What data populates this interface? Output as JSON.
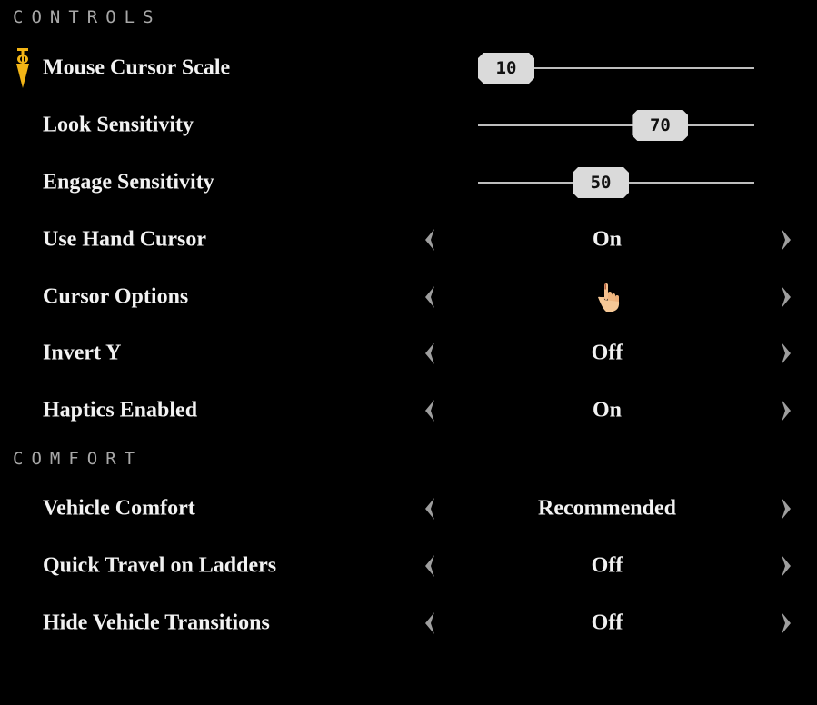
{
  "sections": {
    "controls": {
      "title": "CONTROLS",
      "sliders": [
        {
          "label": "Mouse Cursor Scale",
          "value": "10",
          "fraction": 0.0,
          "focused": true
        },
        {
          "label": "Look Sensitivity",
          "value": "70",
          "fraction": 0.7
        },
        {
          "label": "Engage Sensitivity",
          "value": "50",
          "fraction": 0.43
        }
      ],
      "selectors": [
        {
          "label": "Use Hand Cursor",
          "value": "On"
        },
        {
          "label": "Cursor Options",
          "value": "",
          "value_icon": "hand-pointer-cursor-icon"
        },
        {
          "label": "Invert Y",
          "value": "Off"
        },
        {
          "label": "Haptics Enabled",
          "value": "On"
        }
      ]
    },
    "comfort": {
      "title": "COMFORT",
      "selectors": [
        {
          "label": "Vehicle Comfort",
          "value": "Recommended"
        },
        {
          "label": "Quick Travel on Ladders",
          "value": "Off"
        },
        {
          "label": "Hide Vehicle Transitions",
          "value": "Off"
        }
      ]
    }
  },
  "icons": {
    "focus_marker": "plumb-bob-marker-icon",
    "prev": "chevron-left-icon",
    "next": "chevron-right-icon"
  },
  "colors": {
    "background": "#000000",
    "text": "#f2f2f2",
    "section_header": "#a8a8a8",
    "marker": "#f2b416",
    "slider_track": "#bdbdbd",
    "slider_thumb": "#dadada",
    "arrow": "#9e9e9e"
  }
}
